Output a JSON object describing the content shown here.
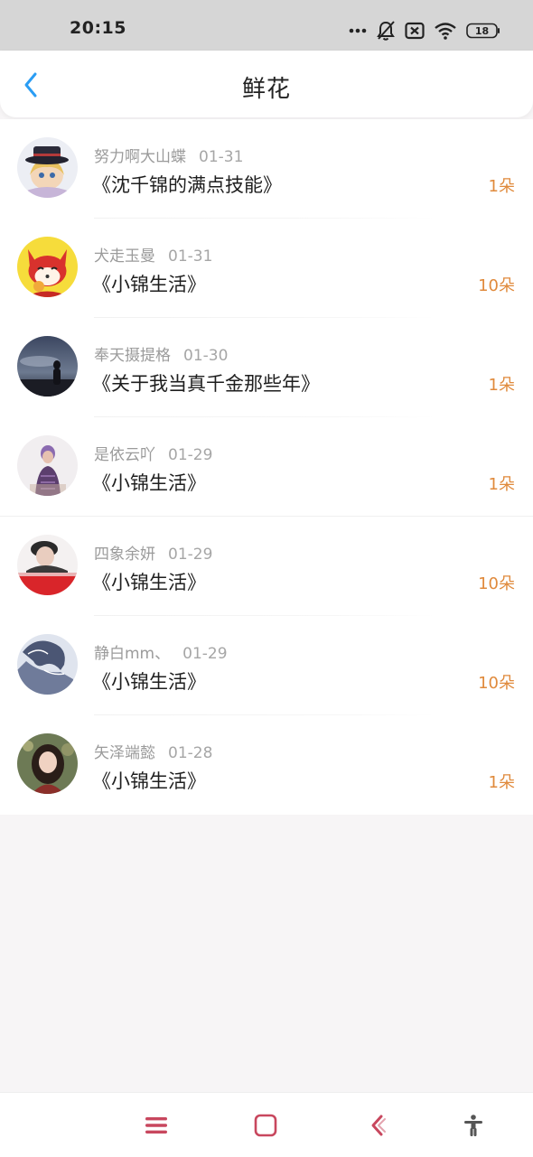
{
  "status_bar": {
    "time": "20:15",
    "battery": "18",
    "icons": [
      "more-dots-icon",
      "bell-muted-icon",
      "sim-x-icon",
      "wifi-icon",
      "battery-icon"
    ]
  },
  "header": {
    "title": "鲜花",
    "back_icon": "chevron-left-icon",
    "accent_color": "#2a9df4"
  },
  "flowers": [
    {
      "user": "努力啊大山蝶",
      "date": "01-31",
      "book": "《沈千锦的满点技能》",
      "count": "1朵"
    },
    {
      "user": "犬走玉曼",
      "date": "01-31",
      "book": "《小锦生活》",
      "count": "10朵"
    },
    {
      "user": "奉天摄提格",
      "date": "01-30",
      "book": "《关于我当真千金那些年》",
      "count": "1朵"
    },
    {
      "user": "是依云吖",
      "date": "01-29",
      "book": "《小锦生活》",
      "count": "1朵"
    },
    {
      "user": "四象余妍",
      "date": "01-29",
      "book": "《小锦生活》",
      "count": "10朵"
    },
    {
      "user": "静白mm、",
      "date": "01-29",
      "book": "《小锦生活》",
      "count": "10朵"
    },
    {
      "user": "矢泽端懿",
      "date": "01-28",
      "book": "《小锦生活》",
      "count": "1朵"
    }
  ],
  "count_color": "#e08a3c",
  "nav_bar": {
    "icons": [
      "menu-icon",
      "home-square-icon",
      "back-chevron-icon",
      "accessibility-icon"
    ],
    "color": "#c8475e"
  }
}
